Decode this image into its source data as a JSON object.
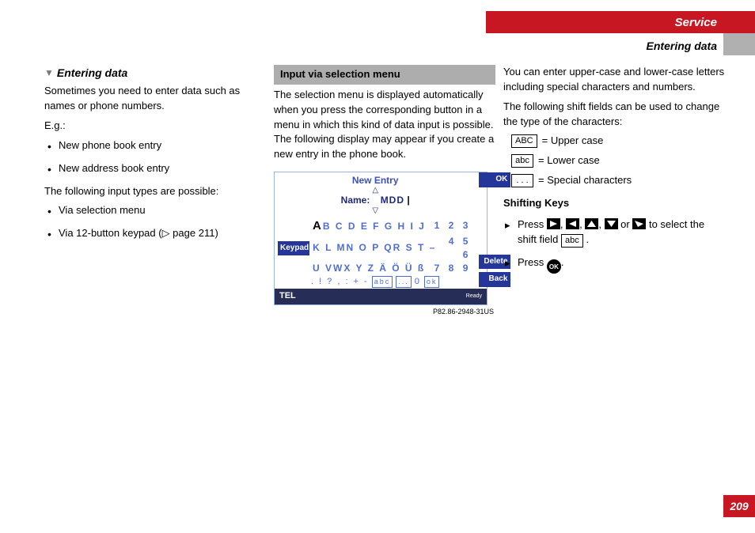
{
  "header": {
    "service": "Service",
    "subhead": "Entering data"
  },
  "col1": {
    "heading": "Entering data",
    "intro": "Sometimes you need to enter data such as names or phone numbers.",
    "eg": "E.g.:",
    "examples": [
      "New phone book entry",
      "New address book entry"
    ],
    "types_intro": "The following input types are possible:",
    "types": [
      "Via selection menu",
      "Via 12-button keypad (▷ page 211)"
    ]
  },
  "col2": {
    "panel": "Input via selection menu",
    "para": "The selection menu is displayed automatically when you press the corresponding button in a menu in which this kind of data input is possible. The following display may appear if you create a new entry in the phone book.",
    "fig": {
      "title": "New Entry",
      "name_label": "Name:",
      "name_value": "MDD",
      "keypad": "Keypad",
      "ok": "OK",
      "delete": "Delete",
      "back": "Back",
      "row1_letters": "B C D E F G H I J",
      "row1_selected": "A",
      "row1_nums": "1 2 3",
      "row2_letters": "K L MN O P QR S T –",
      "row2_nums": "4 5 6",
      "row3_letters": "U VWX Y Z Ä Ö Ü ß",
      "row3_nums": "7 8 9",
      "row4_sym": ". ! ? , : + -",
      "row4_zero": "0",
      "row4_abc": "abc",
      "row4_dots": "...",
      "row4_ok": "ok",
      "footer_tel": "TEL",
      "footer_ready": "Ready",
      "figid": "P82.86-2948-31US"
    }
  },
  "col3": {
    "intro1": "You can enter upper-case and lower-case letters including special characters and numbers.",
    "intro2": "The following shift fields can be used to change the type of the characters:",
    "shift_upper_key": "ABC",
    "shift_upper_txt": "= Upper case",
    "shift_lower_key": "abc",
    "shift_lower_txt": "= Lower case",
    "shift_spec_key": ". . .",
    "shift_spec_txt": "= Special characters",
    "subhead": "Shifting Keys",
    "step1a": "Press ",
    "step1b": " to select the shift field ",
    "step1_or": " or ",
    "step1_comma": ", ",
    "step1_shiftkey": "abc",
    "step1_end": " .",
    "step2a": "Press ",
    "step2b": "."
  },
  "page": "209"
}
